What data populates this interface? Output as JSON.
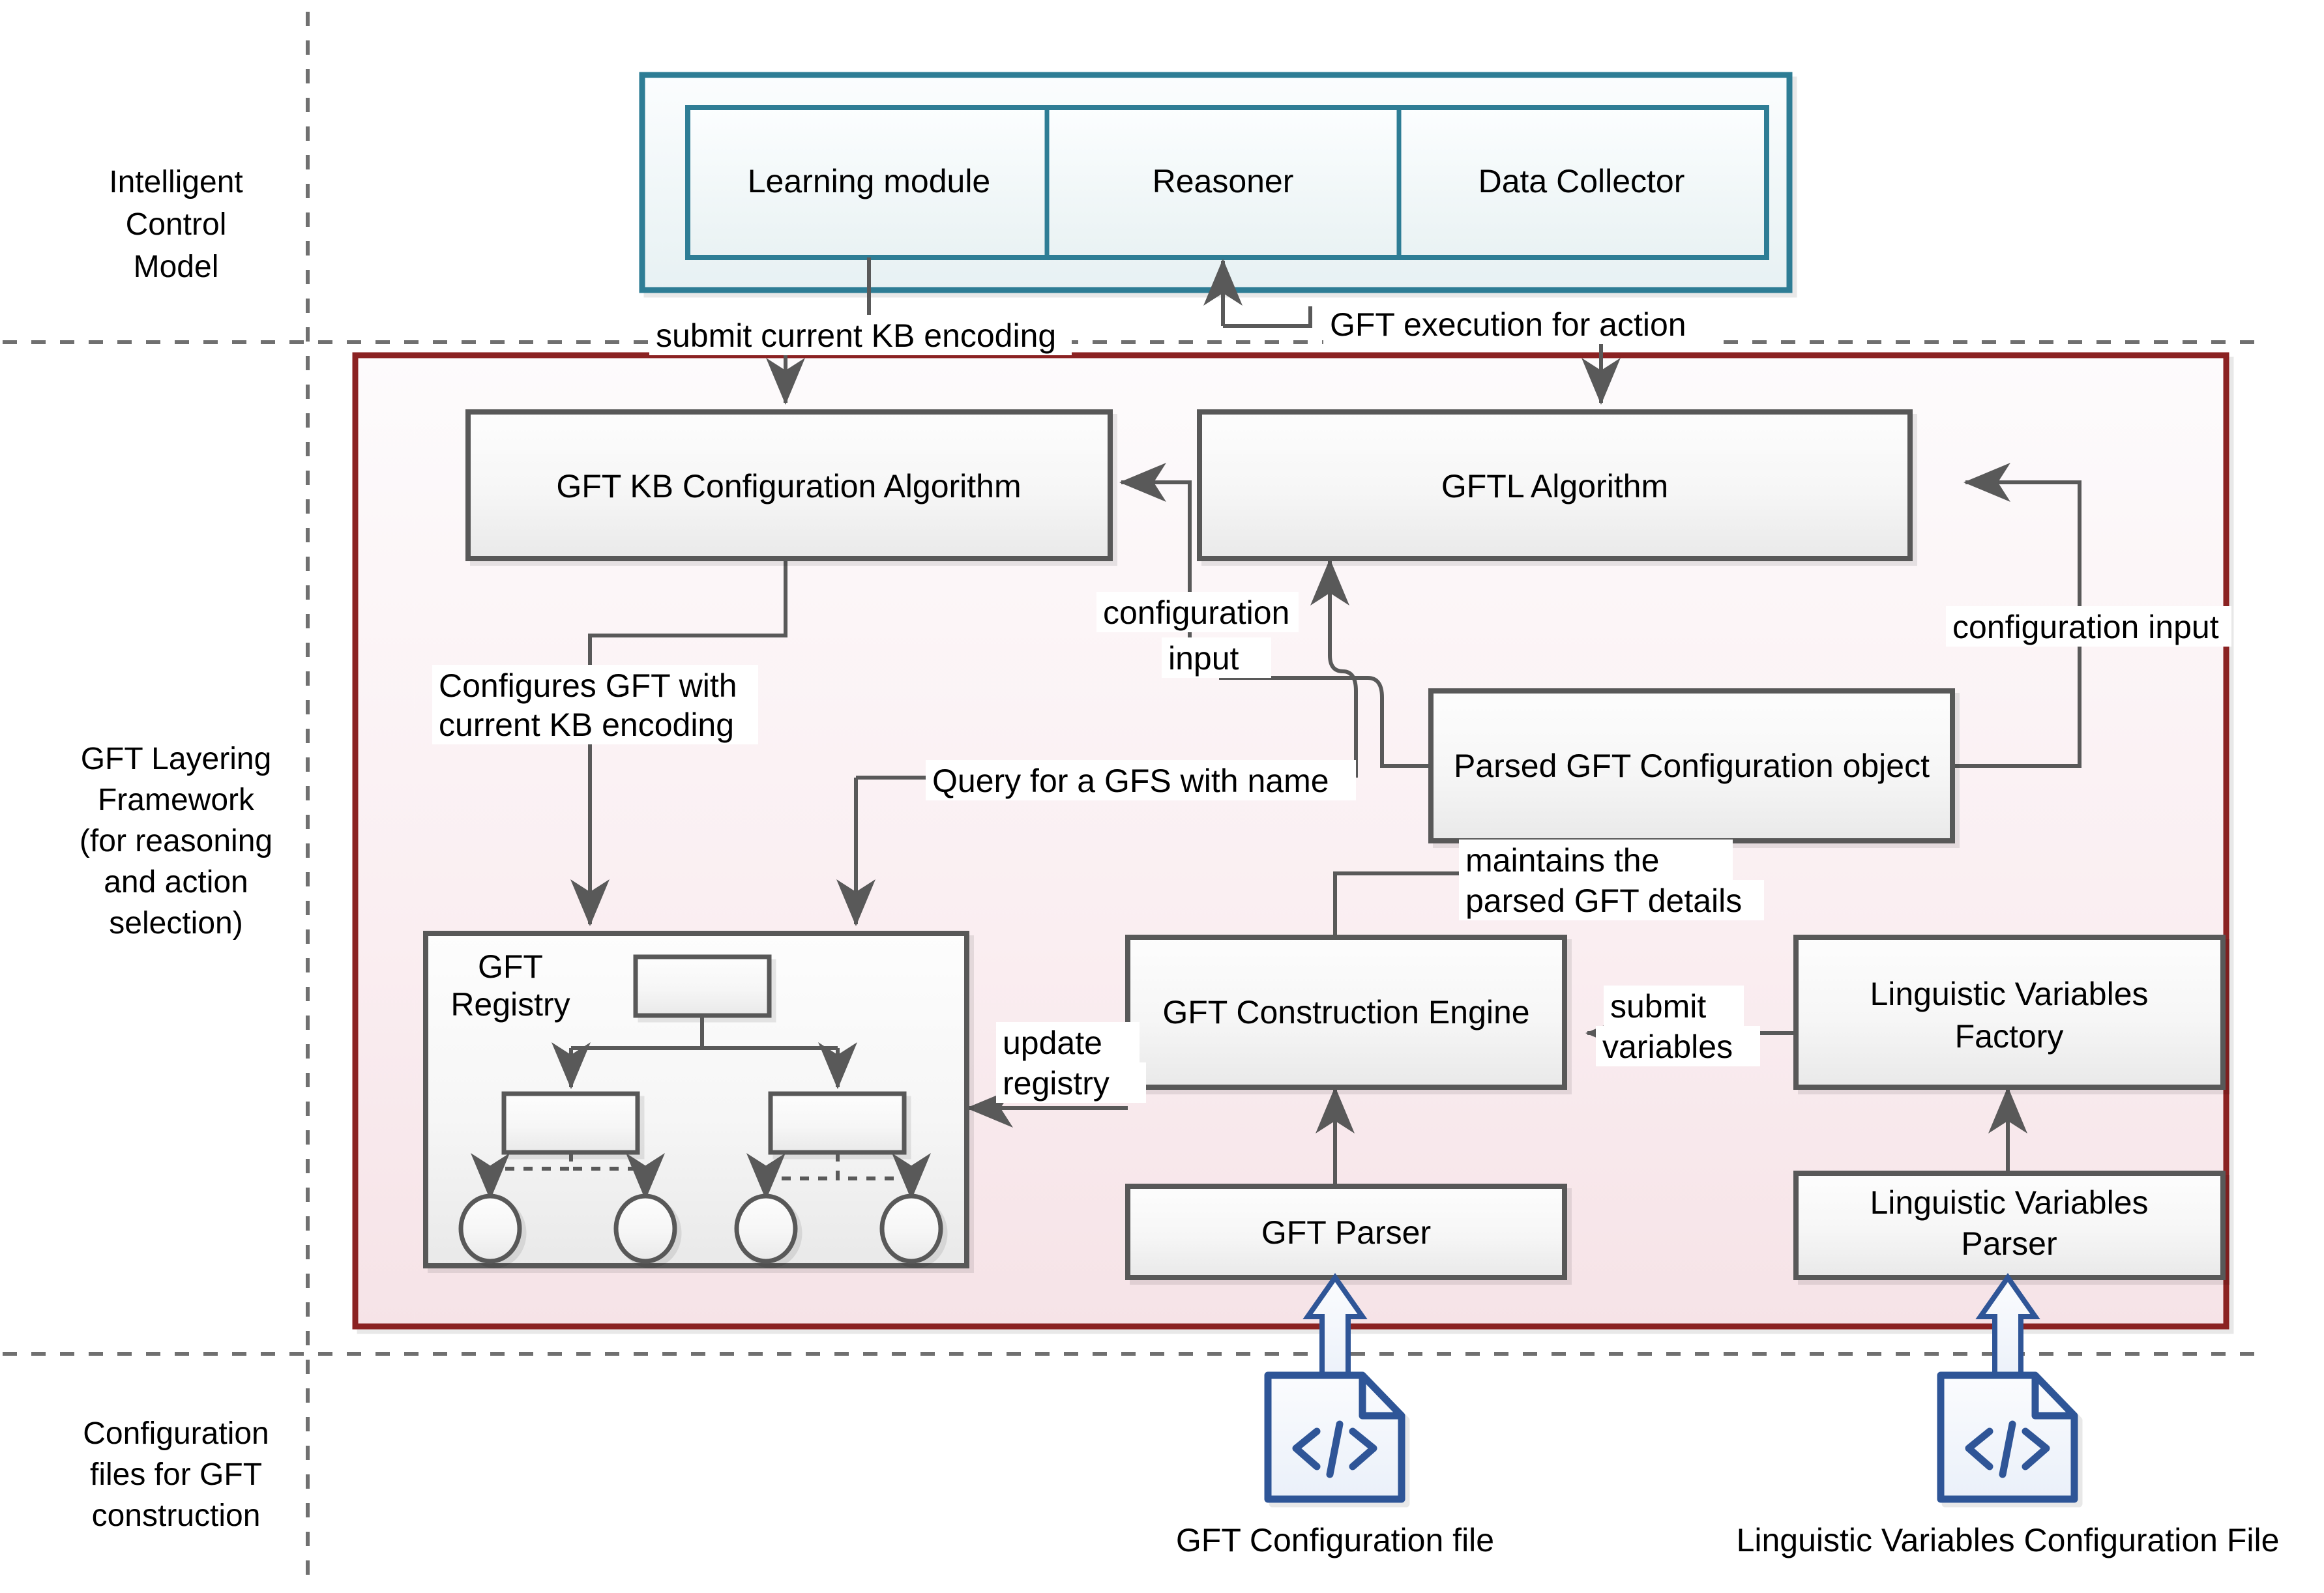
{
  "diagram": {
    "title": "GFT Layering Framework architecture",
    "colors": {
      "teal_border": "#2e7d95",
      "teal_fill_top": "#fbfdfe",
      "teal_fill_bottom": "#e9f2f3",
      "crimson_border": "#8b2020",
      "framework_fill_top": "#fdfafc",
      "framework_fill_bottom": "#f7e4e8",
      "box_border": "#595959",
      "box_fill_top": "#fdfdfd",
      "box_fill_bottom": "#ebebeb",
      "arrow": "#595959",
      "divider": "#595959",
      "file_icon": "#2f5597",
      "file_icon_fill": "#f2f6fc",
      "label_bg": "#ffffff",
      "text": "#000000"
    }
  },
  "lanes": [
    {
      "id": "lane-intelligent-control-model",
      "label": "Intelligent\nControl\nModel",
      "lines": [
        "Intelligent",
        "Control",
        "Model"
      ]
    },
    {
      "id": "lane-gft-layering-framework",
      "label": "GFT Layering Framework (for reasoning and action selection)",
      "lines": [
        "GFT Layering",
        "Framework",
        "(for reasoning",
        "and action",
        "selection)"
      ]
    },
    {
      "id": "lane-configuration-files",
      "label": "Configuration files for GFT construction",
      "lines": [
        "Configuration",
        "files for GFT",
        "construction"
      ]
    }
  ],
  "control_model": {
    "modules": [
      {
        "id": "learning-module",
        "label": "Learning module"
      },
      {
        "id": "reasoner",
        "label": "Reasoner"
      },
      {
        "id": "data-collector",
        "label": "Data Collector"
      }
    ]
  },
  "framework": {
    "boxes": [
      {
        "id": "gft-kb-configuration-algorithm",
        "label": "GFT KB Configuration Algorithm"
      },
      {
        "id": "gftl-algorithm",
        "label": "GFTL Algorithm"
      },
      {
        "id": "parsed-gft-configuration-object",
        "label": "Parsed GFT Configuration object"
      },
      {
        "id": "gft-registry",
        "label": "GFT Registry",
        "lines": [
          "GFT",
          "Registry"
        ]
      },
      {
        "id": "gft-construction-engine",
        "label": "GFT Construction Engine"
      },
      {
        "id": "linguistic-variables-factory",
        "label": "Linguistic Variables Factory",
        "lines": [
          "Linguistic Variables",
          "Factory"
        ]
      },
      {
        "id": "gft-parser",
        "label": "GFT Parser"
      },
      {
        "id": "linguistic-variables-parser",
        "label": "Linguistic Variables Parser",
        "lines": [
          "Linguistic Variables",
          "Parser"
        ]
      }
    ]
  },
  "config_files": [
    {
      "id": "gft-configuration-file",
      "label": "GFT Configuration file"
    },
    {
      "id": "linguistic-variables-configuration-file",
      "label": "Linguistic Variables Configuration File"
    }
  ],
  "edge_labels": [
    {
      "id": "submit-current-kb-encoding",
      "label": "submit current KB encoding",
      "lines": [
        "submit current KB encoding"
      ]
    },
    {
      "id": "gft-execution-for-action",
      "label": "GFT execution for action",
      "lines": [
        "GFT execution for action"
      ]
    },
    {
      "id": "configures-gft-with-current-kb-encoding",
      "label": "Configures GFT with current KB encoding",
      "lines": [
        "Configures GFT with",
        "current KB encoding"
      ]
    },
    {
      "id": "configuration-input-left",
      "label": "configuration input",
      "lines": [
        "configuration",
        "input"
      ]
    },
    {
      "id": "configuration-input-right",
      "label": "configuration input",
      "lines": [
        "configuration input"
      ]
    },
    {
      "id": "query-for-a-gfs-with-name",
      "label": "Query for a GFS with name",
      "lines": [
        "Query for a GFS with name"
      ]
    },
    {
      "id": "maintains-the-parsed-gft-details",
      "label": "maintains the parsed GFT details",
      "lines": [
        "maintains the",
        "parsed GFT details"
      ]
    },
    {
      "id": "update-registry",
      "label": "update registry",
      "lines": [
        "update",
        "registry"
      ]
    },
    {
      "id": "submit-variables",
      "label": "submit variables",
      "lines": [
        "submit",
        "variables"
      ]
    }
  ],
  "registry_tree": {
    "root": {
      "id": "registry-root-node"
    },
    "children": [
      {
        "id": "registry-child-node-1"
      },
      {
        "id": "registry-child-node-2"
      }
    ],
    "leaves": [
      {
        "id": "registry-leaf-1"
      },
      {
        "id": "registry-leaf-2"
      },
      {
        "id": "registry-leaf-3"
      },
      {
        "id": "registry-leaf-4"
      }
    ]
  }
}
